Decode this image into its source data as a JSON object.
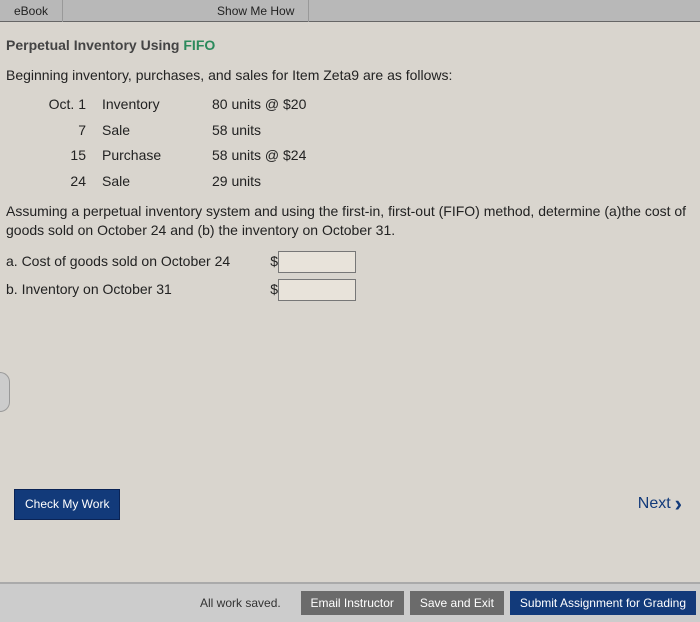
{
  "topbar": {
    "ebook": "eBook",
    "show": "Show Me How"
  },
  "title": {
    "prefix": "Perpetual Inventory Using ",
    "method": "FIFO"
  },
  "intro": "Beginning inventory, purchases, and sales for Item Zeta9 are as follows:",
  "tx": [
    {
      "date": "Oct. 1",
      "type": "Inventory",
      "amt": "80 units @ $20"
    },
    {
      "date": "7",
      "type": "Sale",
      "amt": "58 units"
    },
    {
      "date": "15",
      "type": "Purchase",
      "amt": "58 units @ $24"
    },
    {
      "date": "24",
      "type": "Sale",
      "amt": "29 units"
    }
  ],
  "assume": "Assuming a perpetual inventory system and using the first-in, first-out (FIFO) method, determine (a)the cost of goods sold on October 24 and (b) the inventory on October 31.",
  "q": {
    "a": "a. Cost of goods sold on October 24",
    "b": "b. Inventory on October 31",
    "dollar": "$",
    "a_value": "",
    "b_value": ""
  },
  "check": "Check My Work",
  "next": "Next",
  "bottom": {
    "saved": "All work saved.",
    "email": "Email Instructor",
    "save": "Save and Exit",
    "submit": "Submit Assignment for Grading"
  }
}
